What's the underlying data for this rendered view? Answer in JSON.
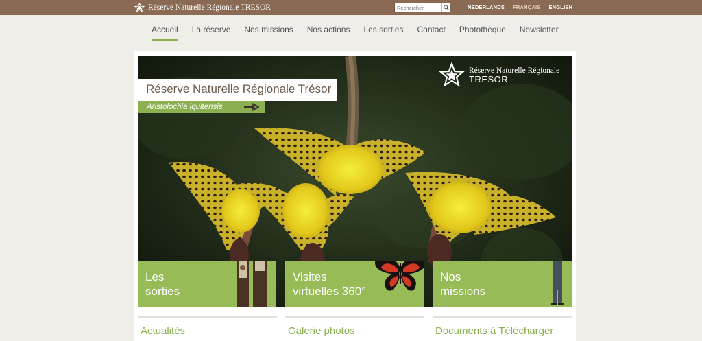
{
  "header": {
    "brand": "Réserve Naturelle Régionale TRESOR",
    "search_placeholder": "Rechercher",
    "languages": [
      {
        "label": "NEDERLANDS",
        "active": false
      },
      {
        "label": "FRANÇAIS",
        "active": true
      },
      {
        "label": "ENGLISH",
        "active": false
      }
    ]
  },
  "nav": {
    "items": [
      "Accueil",
      "La réserve",
      "Nos missions",
      "Nos actions",
      "Les sorties",
      "Contact",
      "Photothèque",
      "Newsletter"
    ]
  },
  "hero": {
    "title": "Réserve Naturelle Régionale Trésor",
    "subtitle": "Aristolochia iquitensis",
    "logo_line1": "Réserve Naturelle Régionale",
    "logo_line2": "TRESOR"
  },
  "tiles": [
    {
      "label": "Les\nsorties"
    },
    {
      "label": "Visites\nvirtuelles 360°"
    },
    {
      "label": "Nos\nmissions"
    }
  ],
  "sections": [
    "Actualités",
    "Galerie photos",
    "Documents à Télécharger"
  ],
  "colors": {
    "brown": "#8a6a52",
    "green": "#97bc57",
    "text_green": "#8ab04f"
  }
}
